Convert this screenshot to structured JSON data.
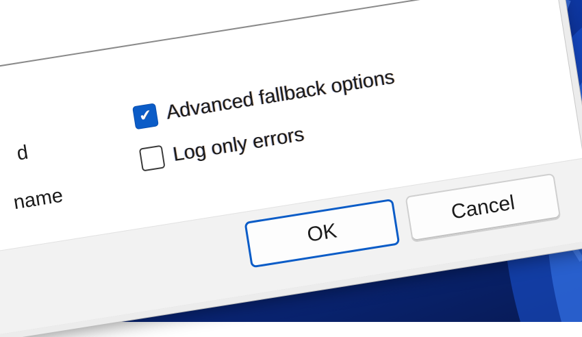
{
  "dialog": {
    "options": {
      "advanced_fallback": {
        "label": "Advanced fallback options",
        "checked": true
      },
      "log_only_errors": {
        "label": "Log only errors",
        "checked": false
      }
    },
    "partial_labels": {
      "upper": "d",
      "lower": "name"
    },
    "buttons": {
      "ok": "OK",
      "cancel": "Cancel"
    },
    "accent_color": "#0B5CC7"
  },
  "icons": {
    "checkbox_check": "checkmark-icon"
  }
}
